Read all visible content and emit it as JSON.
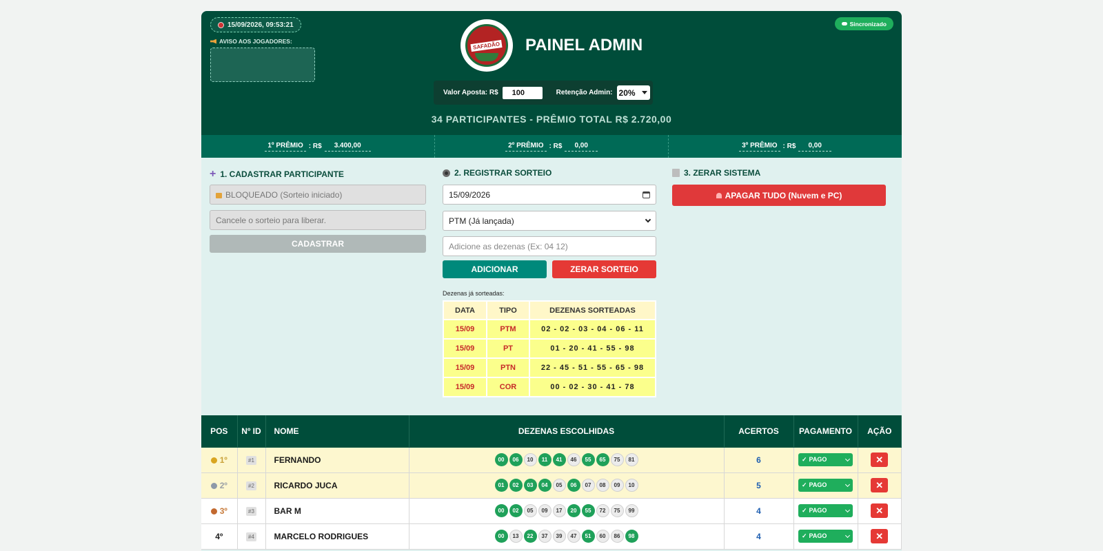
{
  "header": {
    "datetime": "15/09/2026, 09:53:21",
    "notice_label": "AVISO AOS JOGADORES:",
    "notice_text": "",
    "sync_status": "Sincronizado",
    "logo_text": "SAFADÃO",
    "title": "PAINEL ADMIN",
    "bet_label": "Valor Aposta: R$",
    "bet_value": "100",
    "retention_label": "Retenção Admin:",
    "retention_value": "20%",
    "summary": "34 PARTICIPANTES - PRÊMIO TOTAL R$ 2.720,00"
  },
  "prizes": [
    {
      "label": "1º PRÊMIO",
      "currency": ": R$",
      "value": "3.400,00"
    },
    {
      "label": "2º PRÊMIO",
      "currency": ": R$",
      "value": "0,00"
    },
    {
      "label": "3º PRÊMIO",
      "currency": ": R$",
      "value": "0,00"
    }
  ],
  "register": {
    "title": "1. CADASTRAR PARTICIPANTE",
    "locked_text": "BLOQUEADO (Sorteio iniciado)",
    "hint_text": "Cancele o sorteio para liberar.",
    "button": "CADASTRAR"
  },
  "draw": {
    "title": "2. REGISTRAR SORTEIO",
    "date": "15/09/2026",
    "type": "PTM (Já lançada)",
    "numbers_placeholder": "Adicione as dezenas (Ex: 04 12)",
    "add_button": "ADICIONAR",
    "reset_button": "ZERAR SORTEIO",
    "drawn_label": "Dezenas já sorteadas:",
    "columns": [
      "DATA",
      "TIPO",
      "DEZENAS SORTEADAS"
    ],
    "rows": [
      {
        "date": "15/09",
        "type": "PTM",
        "numbers": "02 - 02 - 03 - 04 - 06 - 11"
      },
      {
        "date": "15/09",
        "type": "PT",
        "numbers": "01 - 20 - 41 - 55 - 98"
      },
      {
        "date": "15/09",
        "type": "PTN",
        "numbers": "22 - 45 - 51 - 55 - 65 - 98"
      },
      {
        "date": "15/09",
        "type": "COR",
        "numbers": "00 - 02 - 30 - 41 - 78"
      }
    ]
  },
  "reset": {
    "title": "3. ZERAR SISTEMA",
    "button": "APAGAR TUDO (Nuvem e PC)"
  },
  "participants": {
    "columns": [
      "POS",
      "Nº ID",
      "NOME",
      "DEZENAS ESCOLHIDAS",
      "ACERTOS",
      "PAGAMENTO",
      "AÇÃO"
    ],
    "rows": [
      {
        "pos": "1º",
        "id": "#1",
        "name": "FERNANDO",
        "hits": "6",
        "payment": "PAGO",
        "balls": [
          [
            "00",
            1
          ],
          [
            "06",
            1
          ],
          [
            "10",
            0
          ],
          [
            "11",
            1
          ],
          [
            "41",
            1
          ],
          [
            "46",
            0
          ],
          [
            "55",
            1
          ],
          [
            "65",
            1
          ],
          [
            "75",
            0
          ],
          [
            "81",
            0
          ]
        ]
      },
      {
        "pos": "2º",
        "id": "#2",
        "name": "RICARDO JUCA",
        "hits": "5",
        "payment": "PAGO",
        "balls": [
          [
            "01",
            1
          ],
          [
            "02",
            1
          ],
          [
            "03",
            1
          ],
          [
            "04",
            1
          ],
          [
            "05",
            0
          ],
          [
            "06",
            1
          ],
          [
            "07",
            0
          ],
          [
            "08",
            0
          ],
          [
            "09",
            0
          ],
          [
            "10",
            0
          ]
        ]
      },
      {
        "pos": "3º",
        "id": "#3",
        "name": "BAR M",
        "hits": "4",
        "payment": "PAGO",
        "balls": [
          [
            "00",
            1
          ],
          [
            "02",
            1
          ],
          [
            "05",
            0
          ],
          [
            "09",
            0
          ],
          [
            "17",
            0
          ],
          [
            "20",
            1
          ],
          [
            "55",
            1
          ],
          [
            "72",
            0
          ],
          [
            "75",
            0
          ],
          [
            "99",
            0
          ]
        ]
      },
      {
        "pos": "4º",
        "id": "#4",
        "name": "MARCELO RODRIGUES",
        "hits": "4",
        "payment": "PAGO",
        "balls": [
          [
            "00",
            1
          ],
          [
            "13",
            0
          ],
          [
            "22",
            1
          ],
          [
            "37",
            0
          ],
          [
            "39",
            0
          ],
          [
            "47",
            0
          ],
          [
            "51",
            1
          ],
          [
            "60",
            0
          ],
          [
            "86",
            0
          ],
          [
            "98",
            1
          ]
        ]
      }
    ]
  },
  "colors": {
    "header": "#004d3a",
    "accent": "#00897b",
    "danger": "#e53935",
    "success": "#1fae5c"
  }
}
